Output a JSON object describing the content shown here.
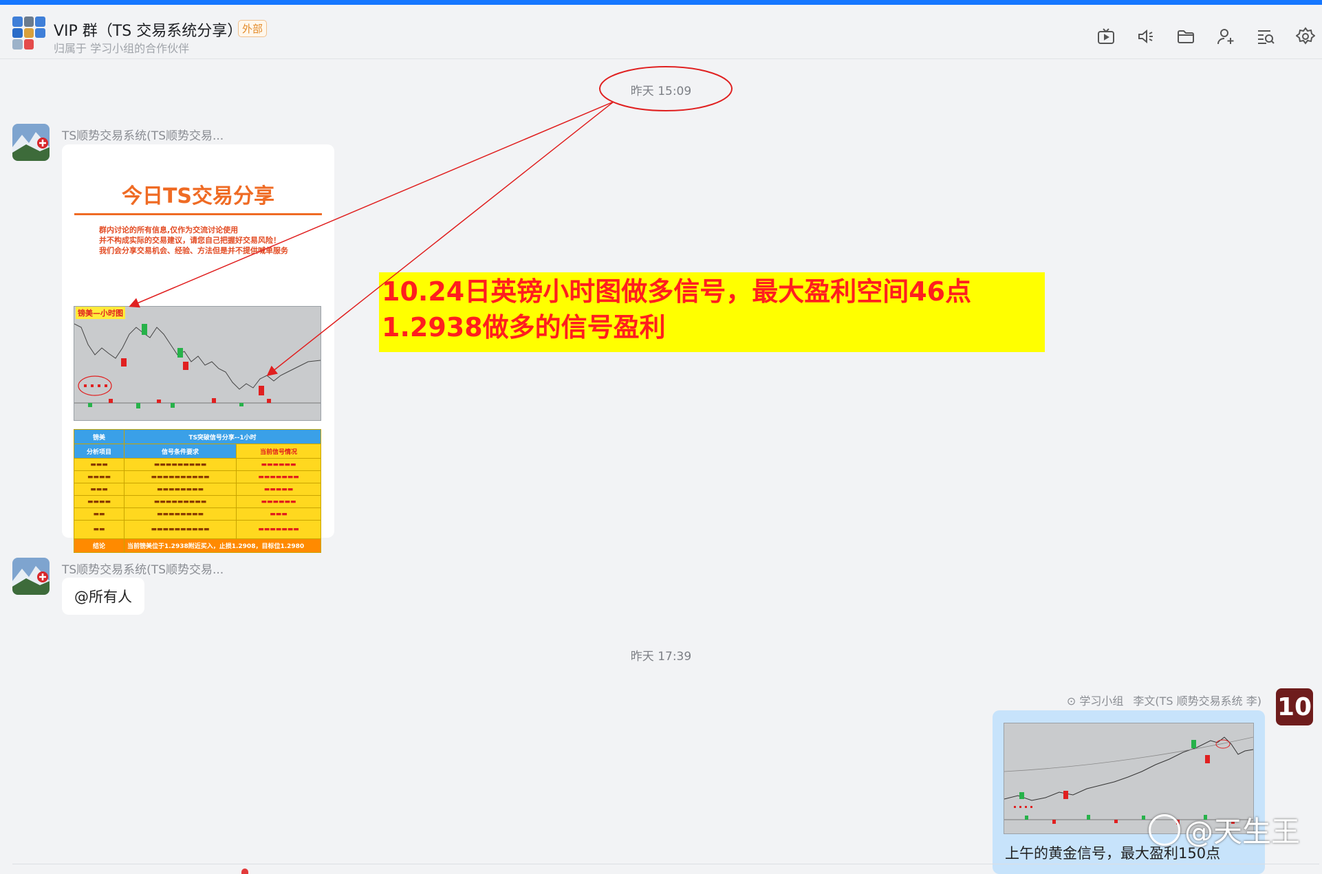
{
  "header": {
    "title": "VIP 群（TS 交易系统分享）",
    "external_badge": "外部",
    "subtitle": "归属于 学习小组的合作伙伴",
    "icons": [
      "tv-icon",
      "speaker-icon",
      "folder-icon",
      "add-member-icon",
      "search-history-icon",
      "settings-icon"
    ]
  },
  "messages": {
    "time1": "昨天 15:09",
    "sender": "TS顺势交易系统(TS顺势交易...",
    "poster": {
      "title": "今日TS交易分享",
      "disclaimer": [
        "群内讨论的所有信息,仅作为交流讨论使用",
        "并不构成实际的交易建议，请您自己把握好交易风险！",
        "我们会分享交易机会、经验、方法但是并不提供喊单服务"
      ],
      "chart_label": "镑美—小时图",
      "table": {
        "col1_head": "镑美",
        "col2_head": "TS突破信号分享--1小时",
        "sub1": "分析项目",
        "sub2": "信号条件要求",
        "sub3": "当前信号情况",
        "conclusion_label": "结论",
        "conclusion_text": "当前镑美位于1.2938附近买入，止损1.2908，目标位1.2980"
      }
    },
    "at_all": "@所有人",
    "time2": "昨天 17:39",
    "my_group": "学习小组",
    "my_name": "李文(TS 顺势交易系统 李)",
    "my_avatar_text": "10",
    "my_caption": "上午的黄金信号，最大盈利150点"
  },
  "annotation": {
    "line1": "10.24日英镑小时图做多信号，最大盈利空间46点",
    "line2": "1.2938做多的信号盈利"
  },
  "watermark": "@天生王",
  "colors": {
    "accent": "#1677ff",
    "highlight": "#ffff00",
    "annotation_text": "#ff1e1e",
    "poster_orange": "#ef6b24"
  }
}
